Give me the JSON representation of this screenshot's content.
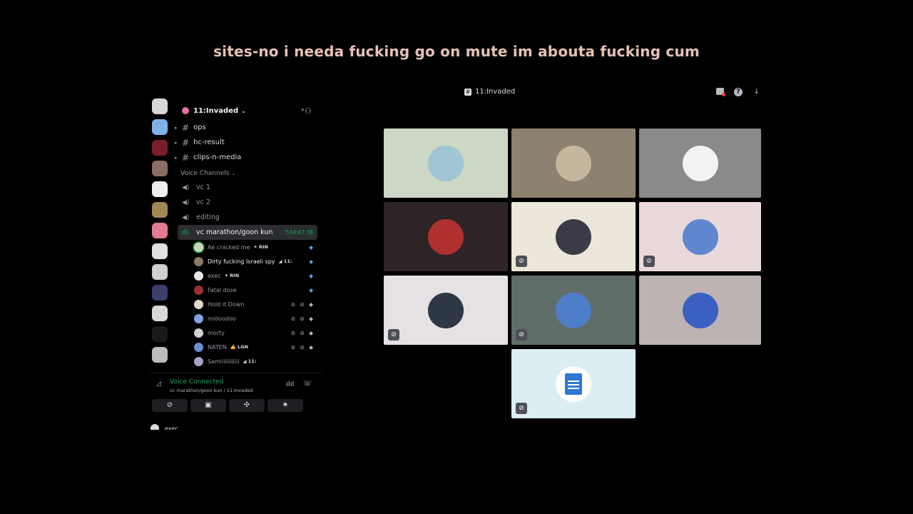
{
  "caption": "sites-no i needa fucking  go on mute im abouta fucking cum",
  "topbar": {
    "channel_title": "11:Invaded",
    "channel_icon": "#"
  },
  "server": {
    "name": "11:Invaded"
  },
  "text_channels": [
    {
      "name": "ops"
    },
    {
      "name": "hc-result"
    },
    {
      "name": "clips-n-media"
    }
  ],
  "voice_category": "Voice Channels",
  "voice_channels": [
    {
      "name": "vc 1"
    },
    {
      "name": "vc 2"
    },
    {
      "name": "editing"
    }
  ],
  "active_voice": {
    "name": "vc marathon/goon kun",
    "timer": "534:47:38"
  },
  "members": [
    {
      "name": "Ae cracked me",
      "tag": "✦ RIN",
      "status": "◆",
      "avatar_color": "#c8d6b7",
      "bright": false,
      "speaking": true
    },
    {
      "name": "Dirty fucking Israeli spy",
      "tag": "◢ 11:",
      "status": "◆",
      "avatar_color": "#8a7a66",
      "bright": true,
      "speaking": false
    },
    {
      "name": "exec",
      "tag": "✦ RIN",
      "status": "◆",
      "avatar_color": "#e8e8e8",
      "bright": false,
      "speaking": false
    },
    {
      "name": "Fatal dose",
      "tag": "",
      "status": "◆",
      "avatar_color": "#9b3131",
      "bright": false,
      "speaking": false
    },
    {
      "name": "Hold it Down",
      "tag": "",
      "status": "⊘ ⊘ ◆",
      "avatar_color": "#e2d9c8",
      "bright": false,
      "speaking": false
    },
    {
      "name": "midoodoo",
      "tag": "",
      "status": "⊘ ⊘ ◆",
      "avatar_color": "#7da4e0",
      "bright": false,
      "speaking": false
    },
    {
      "name": "morty",
      "tag": "",
      "status": "⊘ ⊘ ◆",
      "avatar_color": "#cfcfd4",
      "bright": false,
      "speaking": false
    },
    {
      "name": "NATEN",
      "tag": "👍 LGN",
      "status": "⊘ ⊘ ◆",
      "avatar_color": "#6b8fcf",
      "bright": false,
      "speaking": false
    },
    {
      "name": "Samiiiiiiiiiiii",
      "tag": "◢ 11:",
      "status": "",
      "avatar_color": "#a9a0c9",
      "bright": false,
      "speaking": false
    }
  ],
  "voice_panel": {
    "status": "Voice Connected",
    "location": "vc marathon/goon kun / 11:Invaded"
  },
  "user_panel": {
    "name": "exec"
  },
  "tiles": [
    {
      "bg": "#ccd7c5",
      "avatar": "#9fc6d2",
      "badge": false
    },
    {
      "bg": "#8d8170",
      "avatar": "#c4b79e",
      "badge": false
    },
    {
      "bg": "#8a8a8a",
      "avatar": "#f2f2f2",
      "badge": false
    },
    {
      "bg": "#2e2426",
      "avatar": "#b03030",
      "badge": false
    },
    {
      "bg": "#ece7da",
      "avatar": "#3c3c48",
      "badge": true
    },
    {
      "bg": "#ead9da",
      "avatar": "#5f87d0",
      "badge": true
    },
    {
      "bg": "#e6e1e4",
      "avatar": "#2d3745",
      "badge": true
    },
    {
      "bg": "#5f6d69",
      "avatar": "#4f7ec9",
      "badge": true
    },
    {
      "bg": "#bcb3b2",
      "avatar": "#3c5fc4",
      "badge": false
    },
    {
      "bg": "#dbeef2",
      "avatar": "#2b78d4",
      "badge": true
    }
  ]
}
